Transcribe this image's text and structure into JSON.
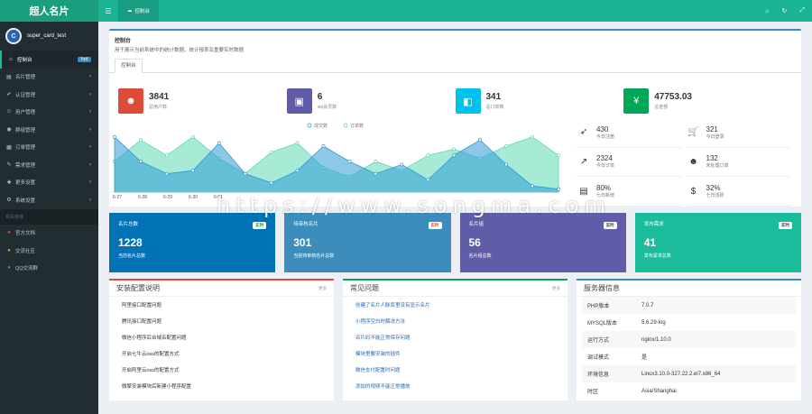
{
  "app": {
    "title": "超人名片",
    "user": "super_card_test",
    "avatar_text": "C"
  },
  "topbar": {
    "tab_label": "控制台"
  },
  "sidebar": {
    "items": [
      {
        "label": "控制台",
        "icon": "home-icon",
        "badge": "hot",
        "active": true
      },
      {
        "label": "名片管理",
        "icon": "card-icon"
      },
      {
        "label": "认证管理",
        "icon": "verify-icon"
      },
      {
        "label": "用户管理",
        "icon": "user-icon"
      },
      {
        "label": "群组管理",
        "icon": "group-icon"
      },
      {
        "label": "订单管理",
        "icon": "order-icon"
      },
      {
        "label": "需求管理",
        "icon": "demand-icon"
      },
      {
        "label": "更多设置",
        "icon": "settings-icon"
      },
      {
        "label": "系统设置",
        "icon": "gear-icon"
      }
    ],
    "section_header": "相关链接",
    "links": [
      {
        "label": "官方文档",
        "color": "#dd4b39"
      },
      {
        "label": "交流社区",
        "color": "#f39c12"
      },
      {
        "label": "QQ交流群",
        "color": "#3c8dbc"
      }
    ]
  },
  "header": {
    "title": "控制台",
    "desc": "用于展示当前系统中的统计数据、统计报表及重要实时数据",
    "tab": "控制台"
  },
  "stats": [
    {
      "value": "3841",
      "label": "总用户数",
      "color": "#dd4b39",
      "icon": "users-icon"
    },
    {
      "value": "6",
      "label": "vip会员数",
      "color": "#605ca8",
      "icon": "book-icon"
    },
    {
      "value": "341",
      "label": "总订单数",
      "color": "#00c0ef",
      "icon": "bag-icon"
    },
    {
      "value": "47753.03",
      "label": "总金额",
      "color": "#00a65a",
      "icon": "yen-icon"
    }
  ],
  "chart_data": {
    "type": "area",
    "legend": [
      "成交数",
      "订单数"
    ],
    "x": [
      "6-27",
      "6-28",
      "6-29",
      "6-30",
      "6-01"
    ],
    "series": [
      {
        "name": "成交数",
        "values": [
          0.9,
          0.5,
          0.3,
          0.35,
          0.8,
          0.3,
          0.15,
          0.35,
          0.75,
          0.5,
          0.3,
          0.45,
          0.2,
          0.6,
          0.85,
          0.45,
          0.1,
          0.05
        ]
      },
      {
        "name": "订单数",
        "values": [
          0.5,
          0.85,
          0.6,
          0.9,
          0.55,
          0.3,
          0.65,
          0.8,
          0.4,
          0.25,
          0.5,
          0.35,
          0.6,
          0.7,
          0.55,
          0.75,
          0.9,
          0.6
        ]
      }
    ]
  },
  "mini_stats": [
    {
      "value": "430",
      "label": "今日注册",
      "icon": "rocket-icon"
    },
    {
      "value": "321",
      "label": "今日登录",
      "icon": "cart-icon"
    },
    {
      "value": "2324",
      "label": "今日订单",
      "icon": "trend-icon"
    },
    {
      "value": "132",
      "label": "未处理订单",
      "icon": "people-icon"
    },
    {
      "value": "80%",
      "label": "七日新增",
      "icon": "table-icon"
    },
    {
      "value": "32%",
      "label": "七日活跃",
      "icon": "dollar-icon"
    }
  ],
  "boxes": [
    {
      "title": "名片总数",
      "badge": "实时",
      "value": "1228",
      "label": "当前名片总数",
      "color": "#0073b7",
      "badge_color": "#00a65a"
    },
    {
      "title": "待审核名片",
      "badge": "实时",
      "value": "301",
      "label": "当前待审核名片总数",
      "color": "#3c8dbc",
      "badge_color": "#dd4b39"
    },
    {
      "title": "名片组",
      "badge": "实时",
      "value": "56",
      "label": "名片组总数",
      "color": "#605ca8",
      "badge_color": "#444"
    },
    {
      "title": "发布需求",
      "badge": "实时",
      "value": "41",
      "label": "发布需求总数",
      "color": "#1abc9c",
      "badge_color": "#444"
    }
  ],
  "install": {
    "title": "安装配置说明",
    "more": "更多",
    "items": [
      "阿里接口配置问题",
      "腾讯接口配置问题",
      "微信小程序后台域名配置问题",
      "开启七牛云oss的配置方式",
      "开启阿里云oss的配置方式",
      "微擎安装模块后新建小程序配置"
    ]
  },
  "faq": {
    "title": "常见问题",
    "more": "更多",
    "items": [
      "创建了名片人脉库里没有显示名片",
      "小程序空白时解决方法",
      "名片码不能正常保存问题",
      "模块里要安装的插件",
      "微信支付配置时问题",
      "添加的视频不能正常播放"
    ]
  },
  "server": {
    "title": "服务器信息",
    "rows": [
      {
        "k": "PHP版本",
        "v": "7.0.7"
      },
      {
        "k": "MYSQL版本",
        "v": "5.6.29-log"
      },
      {
        "k": "运行方式",
        "v": "nginx/1.10.0"
      },
      {
        "k": "调试模式",
        "v": "是"
      },
      {
        "k": "环境信息",
        "v": "Linux3.10.0-327.22.2.el7.x86_64"
      },
      {
        "k": "时区",
        "v": "Asia/Shanghai"
      }
    ]
  },
  "watermark": "https://www.songma.com"
}
